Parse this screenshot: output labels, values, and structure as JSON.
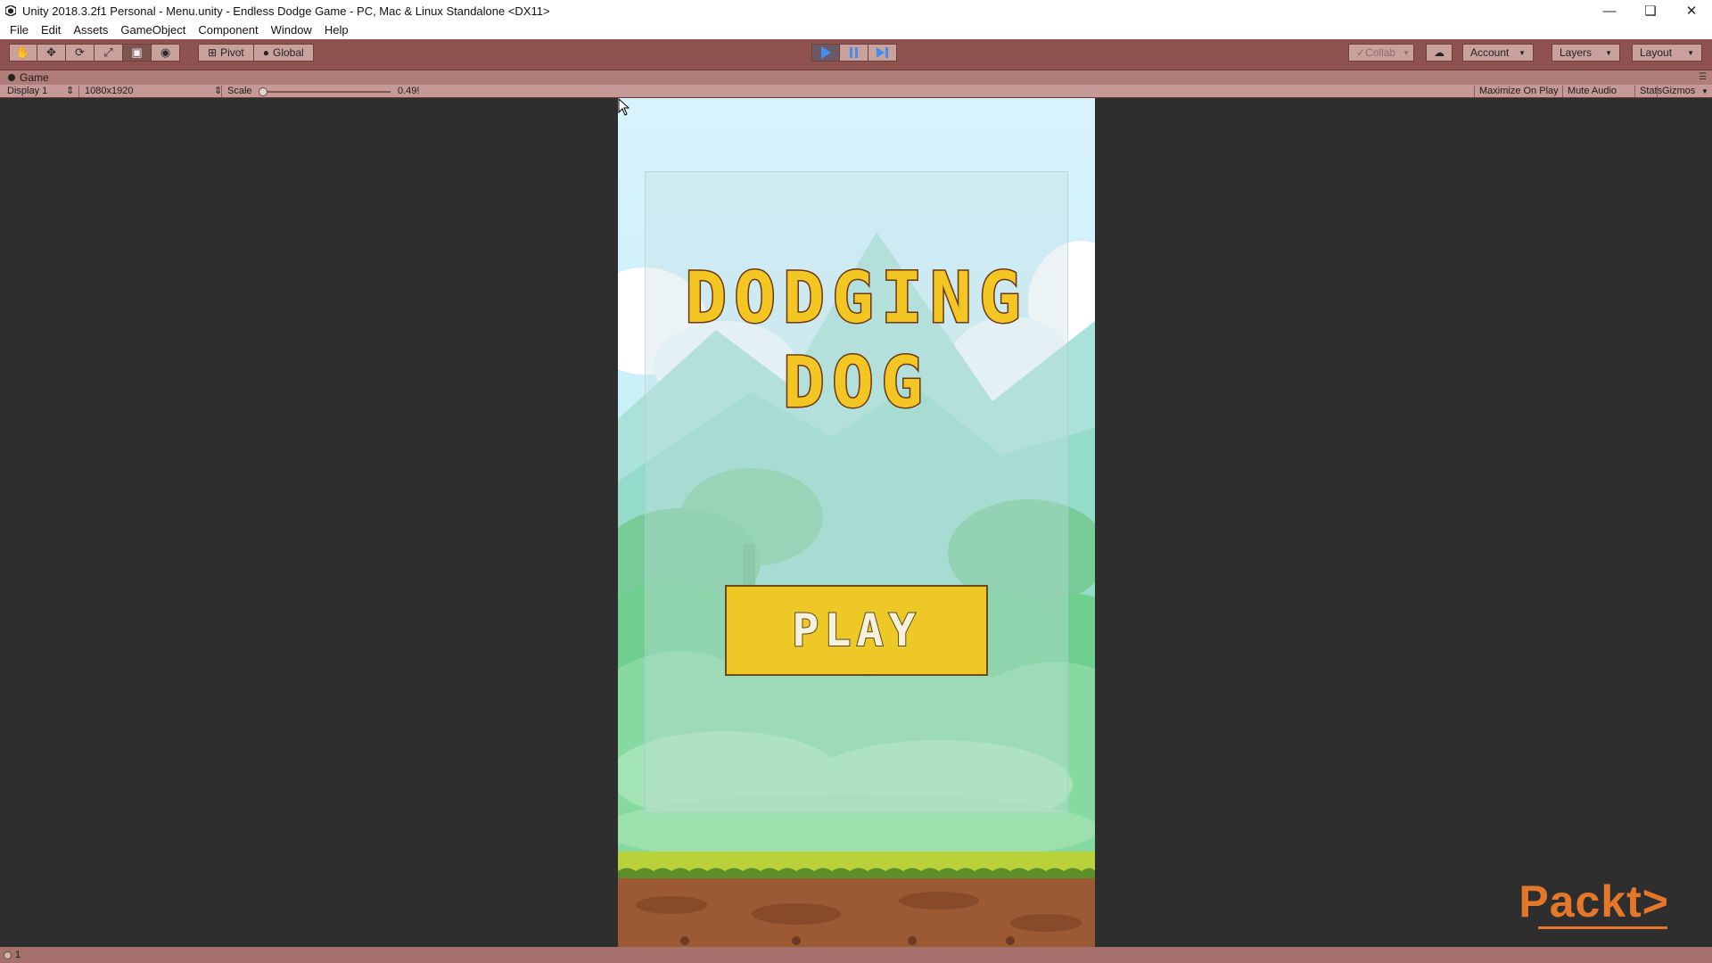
{
  "window": {
    "title": "Unity 2018.3.2f1 Personal - Menu.unity - Endless Dodge Game - PC, Mac & Linux Standalone <DX11>",
    "icon": "unity-icon"
  },
  "menu": [
    "File",
    "Edit",
    "Assets",
    "GameObject",
    "Component",
    "Window",
    "Help"
  ],
  "toolbar": {
    "pivot_label": "Pivot",
    "global_label": "Global",
    "collab_label": "Collab",
    "account_label": "Account",
    "layers_label": "Layers",
    "layout_label": "Layout",
    "tint_color": "#8e524f",
    "play_color": "#3f8ef0"
  },
  "game_view": {
    "tab_label": "Game",
    "display": "Display 1",
    "resolution": "1080x1920",
    "scale_label": "Scale",
    "scale_value": "0.49!",
    "scale_fraction": 0.05,
    "maximize_label": "Maximize On Play",
    "mute_label": "Mute Audio",
    "stats_label": "Stats",
    "gizmos_label": "Gizmos"
  },
  "game": {
    "title_line1": "DODGING",
    "title_line2": "DOG",
    "play_button": "PLAY",
    "title_color": "#f3c623",
    "button_color": "#eec826"
  },
  "watermark": "Packt>",
  "status": {
    "count": "1"
  }
}
